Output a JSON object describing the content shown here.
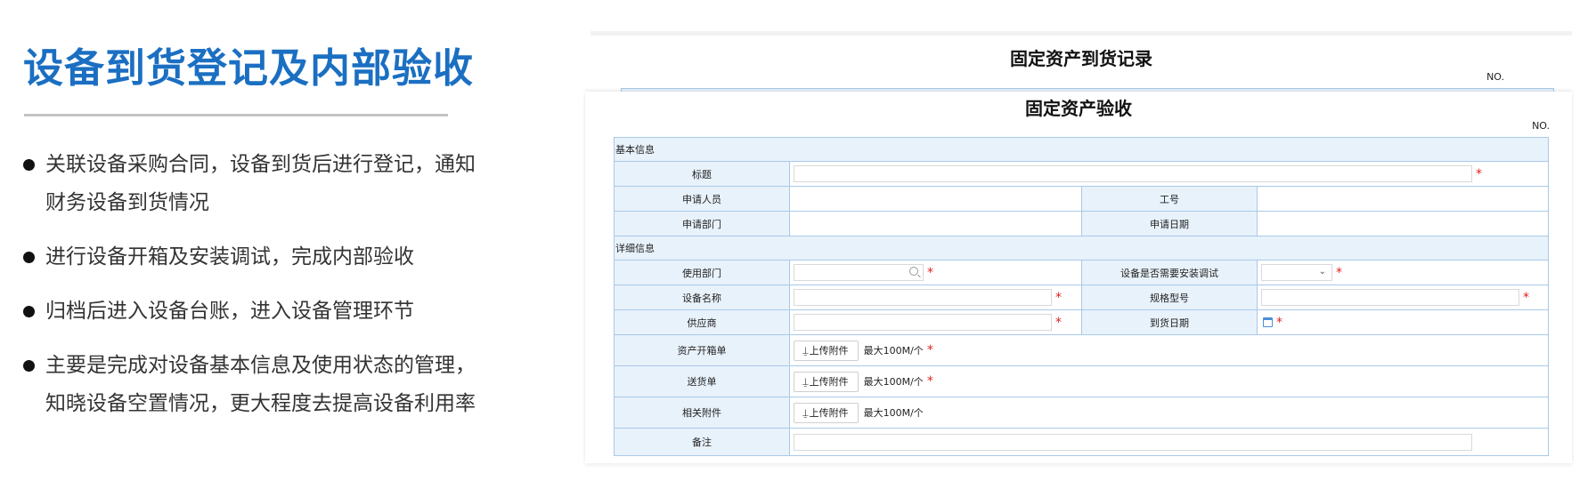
{
  "slide": {
    "title": "设备到货登记及内部验收",
    "bullets": [
      {
        "lines": [
          "关联设备采购合同，设备到货后进行登记，通知",
          "财务设备到货情况"
        ]
      },
      {
        "lines": [
          "进行设备开箱及安装调试，完成内部验收"
        ]
      },
      {
        "lines": [
          "归档后进入设备台账，进入设备管理环节"
        ]
      },
      {
        "lines": [
          "主要是完成对设备基本信息及使用状态的管理，",
          "知晓设备空置情况，更大程度去提高设备利用率"
        ]
      }
    ]
  },
  "record_form": {
    "title": "固定资产到货记录",
    "no_label": "NO."
  },
  "acceptance_form": {
    "title": "固定资产验收",
    "no_label": "NO.",
    "sections": {
      "basic": "基本信息",
      "detail": "详细信息"
    },
    "labels": {
      "title": "标题",
      "applicant": "申请人员",
      "employee_no": "工号",
      "department": "申请部门",
      "apply_date": "申请日期",
      "use_department": "使用部门",
      "need_install": "设备是否需要安装调试",
      "device_name": "设备名称",
      "spec_model": "规格型号",
      "supplier": "供应商",
      "arrival_date": "到货日期",
      "unpacking_sheet": "资产开箱单",
      "delivery_note": "送货单",
      "attachments": "相关附件",
      "remarks": "备注"
    },
    "upload_label": "上传附件",
    "upload_hint": "最大100M/个",
    "required_mark": "*",
    "select_chevron": "⌄",
    "upload_glyph": "⍊"
  },
  "colors": {
    "title_blue": "#1b6fc2",
    "cell_fill": "#e8f2fb",
    "cell_border": "#a9c9e8",
    "required_red": "#e02020"
  },
  "icons": [
    "search-icon",
    "chevron-down-icon",
    "calendar-icon",
    "upload-icon",
    "bullet-dot-icon"
  ]
}
